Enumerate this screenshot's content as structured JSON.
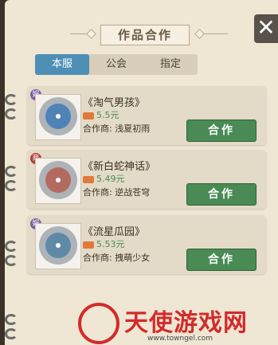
{
  "panel": {
    "title": "作品合作",
    "close_label": "✕"
  },
  "tabs": [
    {
      "label": "本服",
      "active": true
    },
    {
      "label": "公会",
      "active": false
    },
    {
      "label": "指定",
      "active": false
    }
  ],
  "works": [
    {
      "badge": "娱",
      "badge_color": "#7c5aa3",
      "name": "《淘气男孩》",
      "fee": "5.5元",
      "partner_label": "合作商:",
      "partner": "浅夏初雨",
      "action": "合作",
      "disc_color": "#4f83b8"
    },
    {
      "badge": "商",
      "badge_color": "#b53a3a",
      "name": "《新白蛇神话》",
      "fee": "5.49元",
      "partner_label": "合作商:",
      "partner": "逆战苍穹",
      "action": "合作",
      "disc_color": "#b26b5e"
    },
    {
      "badge": "娱",
      "badge_color": "#7c5aa3",
      "name": "《流星瓜园》",
      "fee": "5.53元",
      "partner_label": "合作商:",
      "partner": "拽萌少女",
      "action": "合作",
      "disc_color": "#5e8aa8"
    }
  ],
  "watermark": {
    "text": "天使游戏网",
    "url": "www.towngel.com"
  }
}
